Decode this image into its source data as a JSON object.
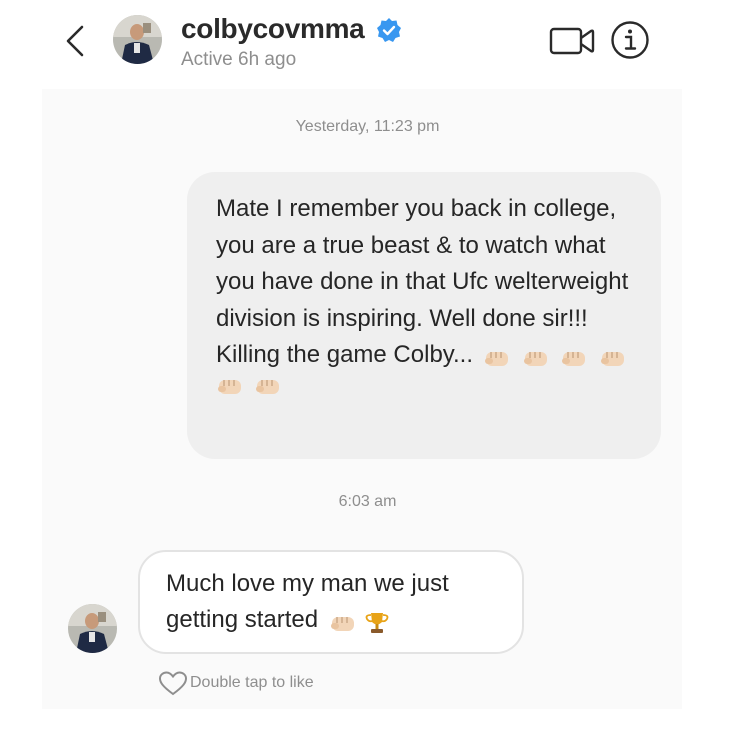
{
  "header": {
    "username": "colbycovmma",
    "status": "Active 6h ago",
    "icons": [
      "chevron-left-icon",
      "avatar",
      "verified-badge-icon",
      "video-camera-icon",
      "info-icon"
    ]
  },
  "colors": {
    "verified_badge": "#3897f0",
    "sent_bubble": "#efefef",
    "text": "#262626",
    "muted_text": "#8e8e8e"
  },
  "conversation": {
    "timestamp_1": "Yesterday, 11:23 pm",
    "message_sent": {
      "text": "Mate I remember you back in college, you are a true beast & to watch what you have done in that Ufc welterweight division is inspiring. Well done sir!!! Killing the game Colby...",
      "emojis": [
        "fist-emoji",
        "fist-emoji",
        "fist-emoji",
        "fist-emoji",
        "fist-emoji",
        "fist-emoji"
      ]
    },
    "timestamp_2": "6:03 am",
    "message_received": {
      "text": "Much love my man we just getting started",
      "emojis": [
        "fist-emoji",
        "trophy-emoji"
      ]
    },
    "like_hint": "Double tap to like"
  }
}
